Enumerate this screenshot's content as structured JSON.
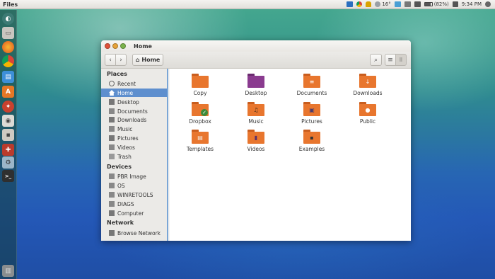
{
  "top_panel": {
    "app_name": "Files",
    "temperature": "16°",
    "battery": "(82%)",
    "time": "9:34 PM"
  },
  "launcher": {
    "apps": [
      "dash-home-icon",
      "file-manager-icon",
      "firefox-icon",
      "chrome-icon",
      "document-icon",
      "software-center-icon",
      "settings-icon",
      "screenshot-icon",
      "disk-utility-icon",
      "toolbox-icon",
      "terminal-icon",
      "trash-icon"
    ]
  },
  "window": {
    "title": "Home",
    "breadcrumb": "Home",
    "sidebar": {
      "places_heading": "Places",
      "places": [
        "Recent",
        "Home",
        "Desktop",
        "Documents",
        "Downloads",
        "Music",
        "Pictures",
        "Videos",
        "Trash"
      ],
      "devices_heading": "Devices",
      "devices": [
        "PBR Image",
        "OS",
        "WINRETOOLS",
        "DIAGS",
        "Computer"
      ],
      "network_heading": "Network",
      "network": [
        "Browse Network"
      ]
    },
    "folders": [
      {
        "label": "Copy",
        "emblem": ""
      },
      {
        "label": "Desktop",
        "emblem": ""
      },
      {
        "label": "Documents",
        "emblem": "≡"
      },
      {
        "label": "Downloads",
        "emblem": "↓"
      },
      {
        "label": "Dropbox",
        "emblem": "✓"
      },
      {
        "label": "Music",
        "emblem": "♫"
      },
      {
        "label": "Pictures",
        "emblem": "▣"
      },
      {
        "label": "Public",
        "emblem": "●"
      },
      {
        "label": "Templates",
        "emblem": "▤"
      },
      {
        "label": "Videos",
        "emblem": "▮"
      },
      {
        "label": "Examples",
        "emblem": "▪"
      }
    ]
  },
  "colors": {
    "folder_orange": "#e8762e",
    "folder_purple": "#8a3b8f",
    "selection_blue": "#5e8fce",
    "close": "#e0533b",
    "minimize": "#e6a33a",
    "maximize": "#7bb34b"
  }
}
